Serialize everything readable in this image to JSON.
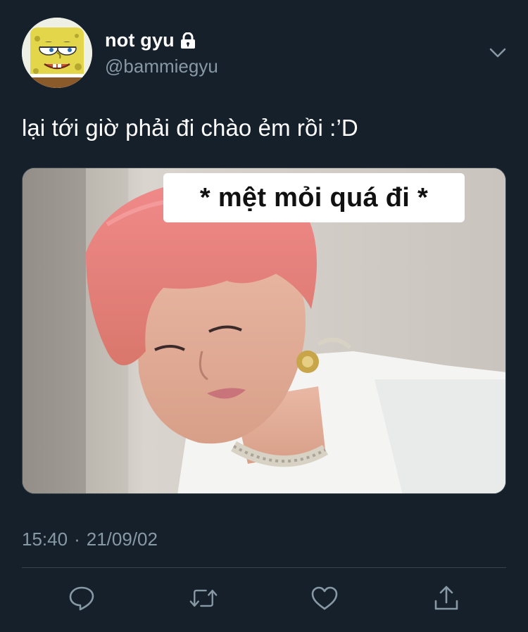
{
  "author": {
    "display_name": "not gyu",
    "handle": "@bammiegyu",
    "protected": true
  },
  "tweet": {
    "text": "lại tới giờ phải đi chào ẻm rồi :’D",
    "media_caption": "* mệt mỏi quá đi *"
  },
  "meta": {
    "time": "15:40",
    "separator": "·",
    "date": "21/09/02"
  },
  "icons": {
    "protected": "lock-icon",
    "menu": "chevron-down-icon",
    "reply": "reply-icon",
    "retweet": "retweet-icon",
    "like": "heart-icon",
    "share": "share-icon"
  },
  "colors": {
    "background": "#15202b",
    "secondary_text": "#8899a6",
    "divider": "#38444d",
    "primary_text": "#ffffff"
  }
}
